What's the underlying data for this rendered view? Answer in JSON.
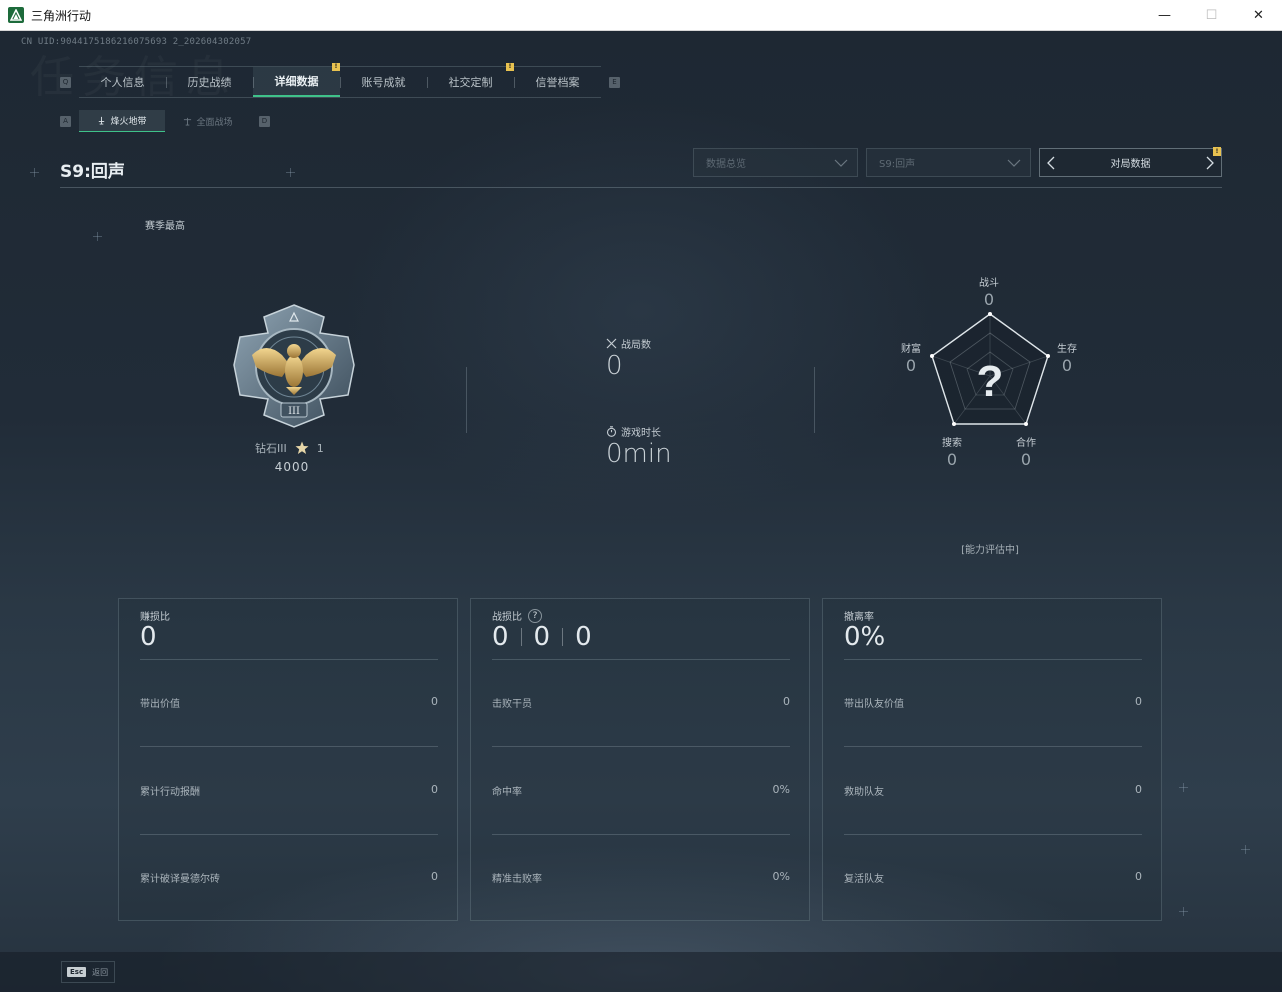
{
  "window": {
    "title": "三角洲行动",
    "minimize": "—",
    "maximize": "☐",
    "close": "✕"
  },
  "uid": "CN UID:9044175186216075693 2_202604302057",
  "background_text": "任务信息",
  "tabs": {
    "left_key": "Q",
    "right_key": "E",
    "items": [
      {
        "label": "个人信息"
      },
      {
        "label": "历史战绩"
      },
      {
        "label": "详细数据",
        "mark": "!"
      },
      {
        "label": "账号成就"
      },
      {
        "label": "社交定制",
        "mark": "!"
      },
      {
        "label": "信誉档案"
      }
    ]
  },
  "subtabs": {
    "left_key": "A",
    "right_key": "D",
    "items": [
      {
        "label": "烽火地带"
      },
      {
        "label": "全面战场"
      }
    ]
  },
  "season": {
    "title": "S9:回声",
    "dropdown_1": "数据总览",
    "dropdown_2": "S9:回声",
    "match_data": "对局数据",
    "match_mark": "!"
  },
  "season_best_label": "赛季最高",
  "rank": {
    "name": "钻石III",
    "stars": "1",
    "score": "4000"
  },
  "battle_count": {
    "label": "战局数",
    "value": "0"
  },
  "play_time": {
    "label": "游戏时长",
    "value": "0min"
  },
  "radar": {
    "center": "?",
    "combat": {
      "label": "战斗",
      "value": "0"
    },
    "survival": {
      "label": "生存",
      "value": "0"
    },
    "cooperation": {
      "label": "合作",
      "value": "0"
    },
    "search": {
      "label": "搜索",
      "value": "0"
    },
    "wealth": {
      "label": "财富",
      "value": "0"
    },
    "status": "[能力评估中]"
  },
  "panels": {
    "profit": {
      "title": "赚损比",
      "value": "0",
      "rows": [
        {
          "label": "带出价值",
          "value": "0"
        },
        {
          "label": "累计行动报酬",
          "value": "0"
        },
        {
          "label": "累计破译曼德尔砖",
          "value": "0"
        }
      ]
    },
    "kd": {
      "title": "战损比",
      "help": "?",
      "values": [
        "0",
        "0",
        "0"
      ],
      "rows": [
        {
          "label": "击败干员",
          "value": "0"
        },
        {
          "label": "命中率",
          "value": "0%"
        },
        {
          "label": "精准击败率",
          "value": "0%"
        }
      ]
    },
    "extract": {
      "title": "撤离率",
      "value": "0%",
      "rows": [
        {
          "label": "带出队友价值",
          "value": "0"
        },
        {
          "label": "救助队友",
          "value": "0"
        },
        {
          "label": "复活队友",
          "value": "0"
        }
      ]
    }
  },
  "footer": {
    "esc_key": "Esc",
    "back_label": "返回"
  },
  "colors": {
    "accent_green": "#3fc28a",
    "notice_yellow": "#e8c250"
  }
}
